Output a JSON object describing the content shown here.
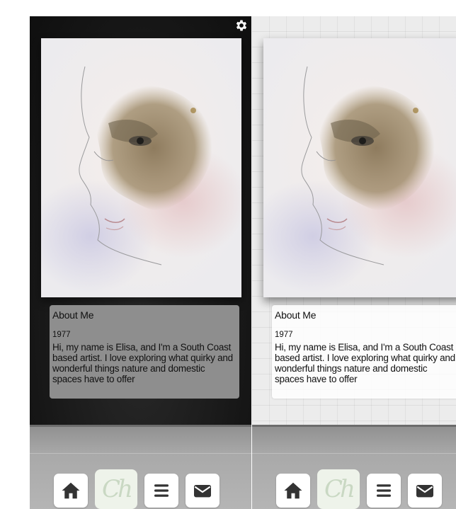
{
  "screens": [
    {
      "theme": "dark",
      "about": {
        "title": "About Me",
        "year": "1977",
        "bio": "Hi, my name is Elisa, and I'm a South Coast based artist. I love exploring what quirky and wonderful things nature and domestic spaces have to offer"
      },
      "show_settings": true
    },
    {
      "theme": "light",
      "about": {
        "title": "About Me",
        "year": "1977",
        "bio": "Hi, my name is Elisa, and I'm a South Coast based artist. I love exploring what quirky and wonderful things nature and domestic spaces have to offer"
      },
      "show_settings": false
    }
  ],
  "nav": {
    "items": [
      {
        "id": "home",
        "icon": "home-icon"
      },
      {
        "id": "logo",
        "icon": "logo-icon",
        "text": "Ch"
      },
      {
        "id": "menu",
        "icon": "menu-icon"
      },
      {
        "id": "mail",
        "icon": "mail-icon"
      }
    ]
  },
  "icons": {
    "settings": "gear-icon"
  },
  "colors": {
    "dark_bg": "#161616",
    "card_dark": "#8e8e8e",
    "card_light": "#ffffff",
    "nav_button": "#ffffff",
    "logo_bg": "#eef3ea",
    "logo_fg": "#c9d8c3",
    "icon": "#333333"
  }
}
